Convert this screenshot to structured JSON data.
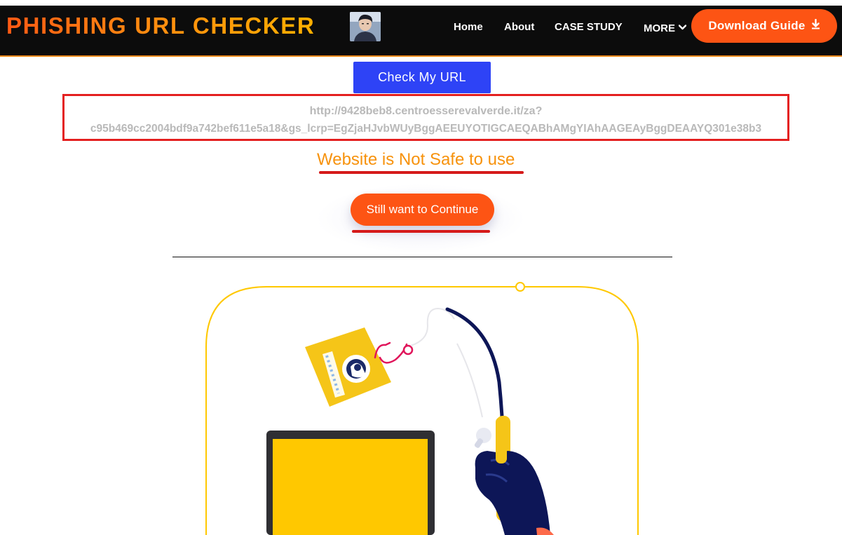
{
  "navbar": {
    "brand": "PHISHING URL CHECKER",
    "links": [
      {
        "label": "Home"
      },
      {
        "label": "About"
      },
      {
        "label": "CASE STUDY"
      },
      {
        "label": "MORE"
      }
    ],
    "download_label": "Download Guide",
    "icons": {
      "more": "chevron-down-icon",
      "download": "download-icon"
    }
  },
  "check_button_label": "Check My URL",
  "url": {
    "line1": "http://9428beb8.centroesserevalverde.it/za?",
    "line2": "c95b469cc2004bdf9a742bef611e5a18&gs_lcrp=EgZjaHJvbWUyBggAEEUYOTIGCAEQABhAMgYIAhAAGEAyBggDEAAYQ301e38b3"
  },
  "warning_text": "Website is Not Safe to use",
  "continue_label": "Still want to Continue",
  "colors": {
    "accent_orange": "#fd5414",
    "check_blue": "#2e43f6",
    "warning_orange": "#f7920c",
    "alert_red": "#e42020",
    "illustration_yellow": "#ffc800",
    "illustration_navy": "#0d1657"
  }
}
